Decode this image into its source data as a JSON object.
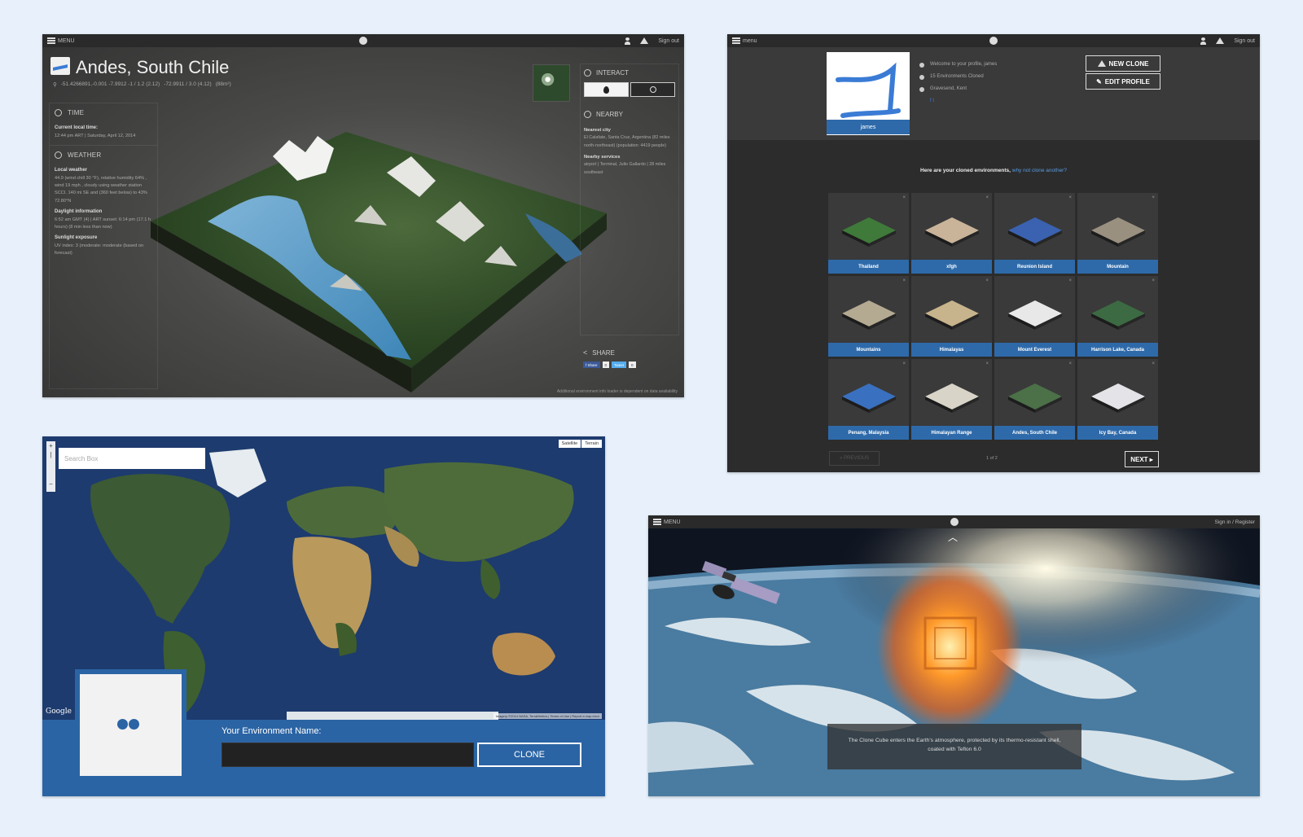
{
  "panel1": {
    "topbar": {
      "menu": "MENU",
      "signout": "Sign out"
    },
    "title": "Andes, South Chile",
    "coords": [
      "-51.4266891,-0.001 -7.9912 -1 / 1.2 (2.12)",
      "-72.9911 / 3.0 (4.12)",
      "(88m²)"
    ],
    "time": {
      "heading": "TIME",
      "label": "Current local time:",
      "value": "12:44 pm ART | Saturday, April 12, 2014"
    },
    "weather": {
      "heading": "WEATHER",
      "local_label": "Local weather",
      "local_text": "44.9 (wind chill 30 °F), relative humidity 64% , wind 19 mph , cloudy using weather station SCCI. 140 mi SE and (360 feet below) to 43% 72.80°N",
      "daylight_label": "Daylight information",
      "daylight_text": "6:52 am GMT (4) | ART sunset: 6:14 pm (17.1 h hours) (8 min less than now)",
      "sunlight_label": "Sunlight exposure",
      "sunlight_text": "UV index: 3 (moderate: moderate (based on forecast)"
    },
    "interact": {
      "heading": "INTERACT"
    },
    "nearby": {
      "heading": "NEARBY",
      "city_label": "Nearest city",
      "city_text": "El Calafate, Santa Cruz, Argentina (82 miles north-northeast) (population: 4419 people)",
      "services_label": "Nearby services",
      "services_text": "airport | Terminal, Julio Gallardo | 28 miles southeast"
    },
    "share": {
      "heading": "SHARE",
      "fb": "f Share",
      "tw": "Tweet",
      "count": "0"
    },
    "footnote": "Additional environment info loader is dependent on data availability"
  },
  "panel2": {
    "topbar": {
      "menu": "menu",
      "signout": "Sign out"
    },
    "avatar_name": "james",
    "profile_lines": [
      "Welcome to your profile, james",
      "15 Environments Cloned",
      "Gravesend, Kent"
    ],
    "social": "f  t",
    "new_clone": "NEW CLONE",
    "edit_profile": "EDIT PROFILE",
    "intro": "Here are your cloned environments,",
    "intro_link": "why not clone another?",
    "tiles": [
      {
        "name": "Thailand",
        "color": "#3f7a3a"
      },
      {
        "name": "xfgh",
        "color": "#c9b49a"
      },
      {
        "name": "Reunion Island",
        "color": "#3a62b0"
      },
      {
        "name": "Mountain",
        "color": "#9a9080"
      },
      {
        "name": "Mountains",
        "color": "#b4aa92"
      },
      {
        "name": "Himalayas",
        "color": "#c8b48c"
      },
      {
        "name": "Mount Everest",
        "color": "#e8e8e8"
      },
      {
        "name": "Harrison Lake, Canada",
        "color": "#3c6a42"
      },
      {
        "name": "Penang, Malaysia",
        "color": "#3a70c0"
      },
      {
        "name": "Himalayan Range",
        "color": "#d8d4c8"
      },
      {
        "name": "Andes, South Chile",
        "color": "#4c7048"
      },
      {
        "name": "Icy Bay, Canada",
        "color": "#e4e4e8"
      }
    ],
    "prev": "« PREVIOUS",
    "page": "1 of 2",
    "next": "NEXT ▸"
  },
  "panel3": {
    "search_placeholder": "Search Box",
    "map_types": [
      "Satellite",
      "Terrain"
    ],
    "google": "Google",
    "attribution": "Imagery ©2014 NASA, TerraMetrics | Terms of Use | Report a map error",
    "env_label": "Your Environment Name:",
    "env_value": "",
    "clone": "CLONE"
  },
  "panel4": {
    "topbar": {
      "menu": "MENU",
      "signin": "Sign in / Register"
    },
    "caption": "The Clone Cube enters the Earth's atmosphere, protected by its thermo-resistant shell, coated with Teflon 6.0"
  }
}
